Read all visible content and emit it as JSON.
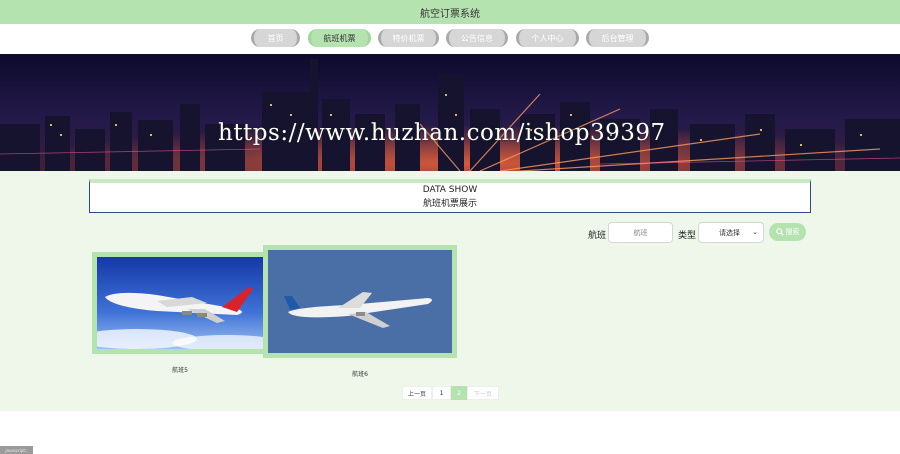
{
  "header": {
    "title": "航空订票系统"
  },
  "nav": {
    "items": [
      {
        "label": "首页",
        "active": false
      },
      {
        "label": "航班机票",
        "active": true
      },
      {
        "label": "特价机票",
        "active": false
      },
      {
        "label": "公告信息",
        "active": false
      },
      {
        "label": "个人中心",
        "active": false
      },
      {
        "label": "后台管理",
        "active": false
      }
    ]
  },
  "banner": {
    "watermark": "https://www.huzhan.com/ishop39397"
  },
  "section": {
    "title_en": "DATA SHOW",
    "title_cn": "航班机票展示"
  },
  "filters": {
    "flight_label": "航班",
    "flight_placeholder": "航班",
    "type_label": "类型",
    "type_value": "请选择",
    "search_label": "搜索"
  },
  "cards": [
    {
      "name": "航班5"
    },
    {
      "name": "航班6"
    }
  ],
  "pagination": {
    "prev": "上一页",
    "page1": "1",
    "page2": "2",
    "next": "下一页"
  },
  "corner": {
    "label": "javascript:;"
  },
  "colors": {
    "accent": "#b5e3b0",
    "background": "#eef7ea",
    "frame": "#2c4a86"
  }
}
